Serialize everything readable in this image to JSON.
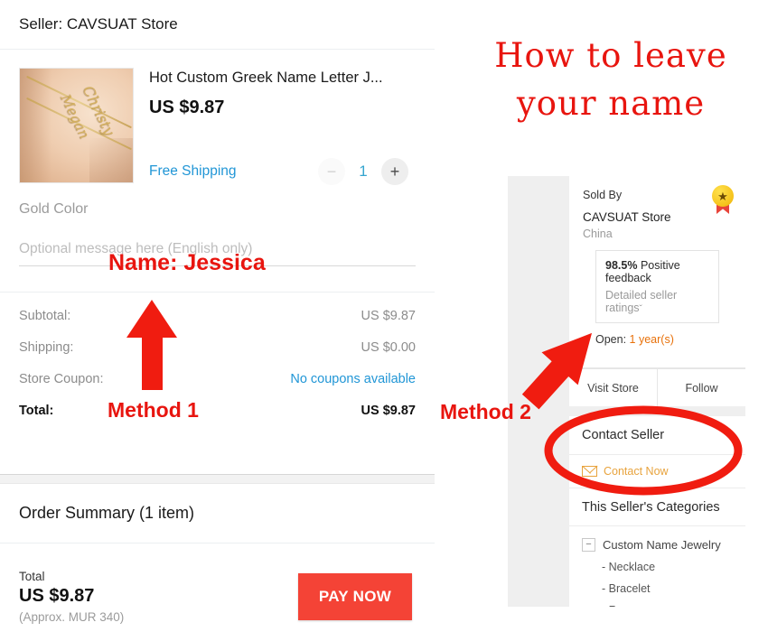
{
  "checkout": {
    "seller_header": "Seller: CAVSUAT Store",
    "product": {
      "title": "Hot Custom Greek Name Letter J...",
      "price": "US $9.87",
      "shipping_label": "Free Shipping",
      "qty_minus": "−",
      "qty_value": "1",
      "qty_plus": "+",
      "thumb_charm_1": "Megan",
      "thumb_charm_2": "Christy"
    },
    "variant": "Gold Color",
    "message_placeholder": "Optional message here (English only)",
    "totals": [
      {
        "label": "Subtotal:",
        "value": "US $9.87",
        "link": false
      },
      {
        "label": "Shipping:",
        "value": "US $0.00",
        "link": false
      },
      {
        "label": "Store Coupon:",
        "value": "No coupons available",
        "link": true
      }
    ],
    "grand_total": {
      "label": "Total:",
      "value": "US $9.87"
    },
    "order_summary": "Order Summary (1 item)",
    "pay_bar": {
      "total_label": "Total",
      "total_value": "US $9.87",
      "approx": "(Approx. MUR 340)",
      "pay_button": "PAY NOW"
    }
  },
  "right": {
    "howto_title": "How to leave your name",
    "seller_card": {
      "sold_by": "Sold By",
      "store_name": "CAVSUAT Store",
      "country": "China",
      "badge_icon": "medal-star-icon",
      "feedback_percent": "98.5%",
      "feedback_label": "Positive feedback",
      "detailed_ratings": "Detailed seller ratings",
      "chevron": "ˇ",
      "open_label": "Open:",
      "open_value": "1 year(s)",
      "visit_store": "Visit Store",
      "follow": "Follow",
      "contact_seller": "Contact Seller",
      "contact_now": "Contact Now",
      "contact_icon": "envelope-icon",
      "categories_heading": "This Seller's Categories",
      "category_parent": "Custom Name Jewelry",
      "category_toggle": "−",
      "category_children": [
        "- Necklace",
        "- Bracelet"
      ]
    }
  },
  "annotations": {
    "name_jessica": "Name: Jessica",
    "method1": "Method 1",
    "method2": "Method 2",
    "accent_color": "#e8150f"
  }
}
